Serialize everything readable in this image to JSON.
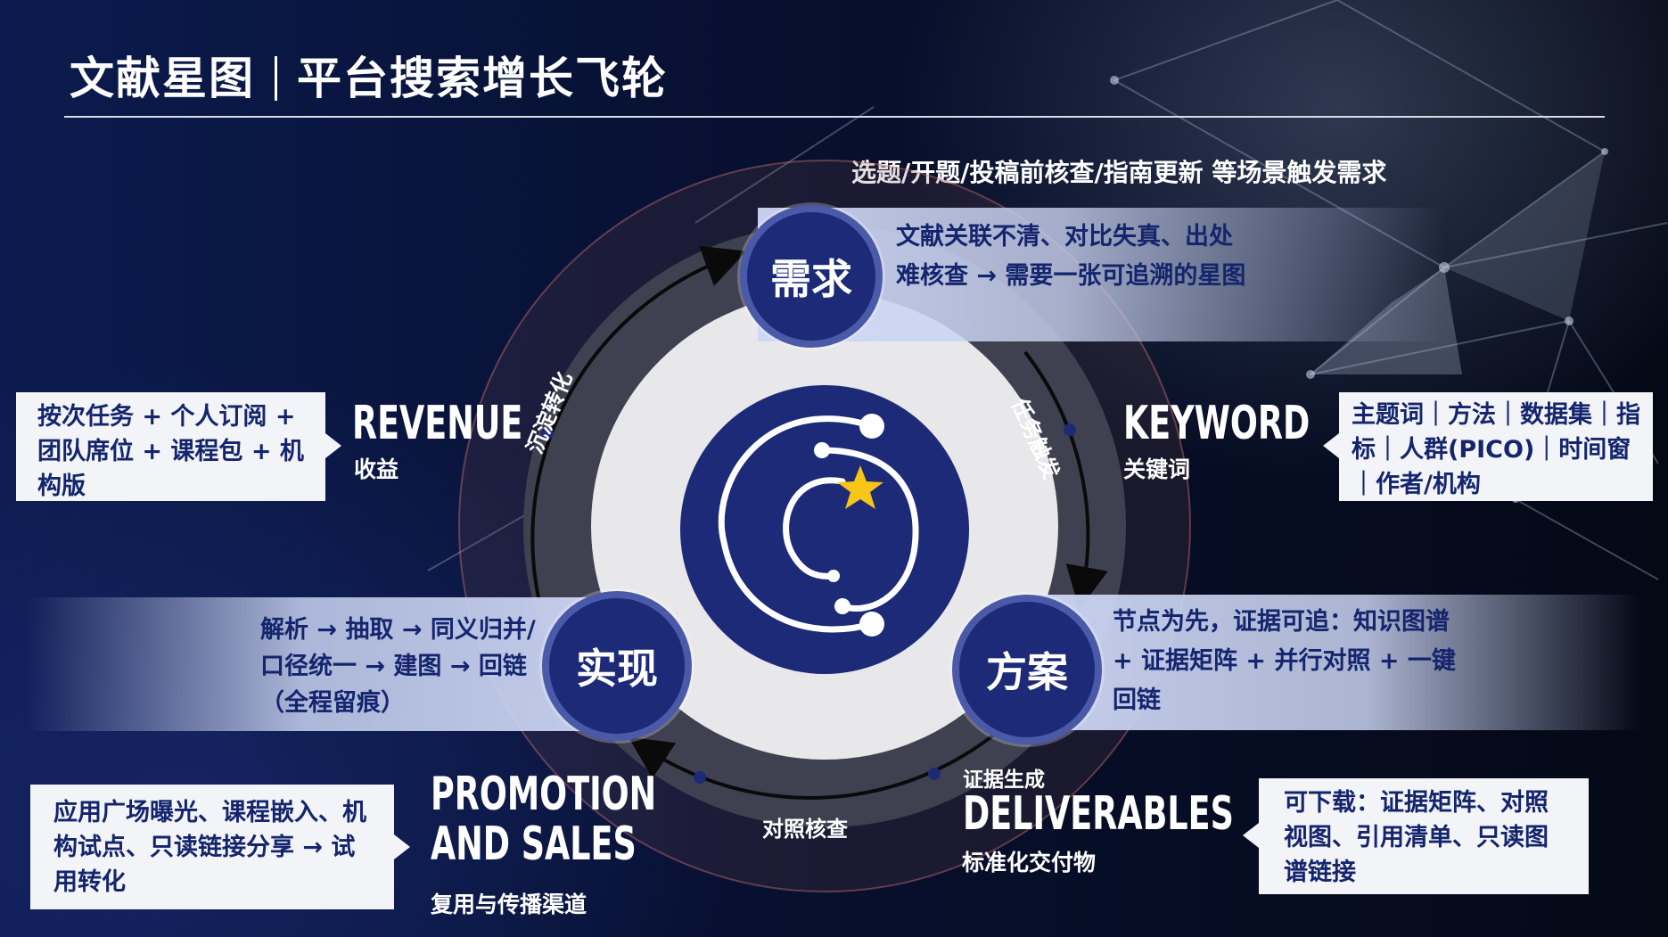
{
  "title": {
    "left": "文献星图",
    "right": "平台搜索增长飞轮"
  },
  "trigger": "选题/开题/投稿前核查/指南更新 等场景触发需求",
  "nodes": {
    "demand": "需求",
    "plan": "方案",
    "impl": "实现"
  },
  "demand_text": "文献关联不清、对比失真、出处难核查 → 需要一张可追溯的星图",
  "plan_text": "节点为先，证据可追：知识图谱 + 证据矩阵 + 并行对照 + 一键回链",
  "impl_text": "解析 → 抽取 → 同义归并/口径统一 → 建图 → 回链（全程留痕）",
  "revenue": {
    "label": "REVENUE",
    "sub": "收益",
    "card": "按次任务 + 个人订阅 + 团队席位 + 课程包 + 机构版"
  },
  "keyword": {
    "label": "KEYWORD",
    "sub": "关键词",
    "card": "主题词｜方法｜数据集｜指标｜人群(PICO)｜时间窗｜作者/机构"
  },
  "promotion": {
    "label_line1": "PROMOTION",
    "label_line2": "AND SALES",
    "sub": "复用与传播渠道",
    "card": "应用广场曝光、课程嵌入、机构试点、只读链接分享 → 试用转化"
  },
  "deliverables": {
    "label": "DELIVERABLES",
    "sub": "标准化交付物",
    "evidence": "证据生成",
    "card": "可下载：证据矩阵、对照视图、引用清单、只读图谱链接"
  },
  "arc_labels": {
    "sediment": "沉淀转化",
    "task": "任务触发",
    "compare": "对照核查"
  },
  "colors": {
    "navy": "#1c2a78",
    "band": "#cdd7f5",
    "card_text": "#14256e",
    "card_bg": "#f3f4f7",
    "star": "#f5c518"
  }
}
